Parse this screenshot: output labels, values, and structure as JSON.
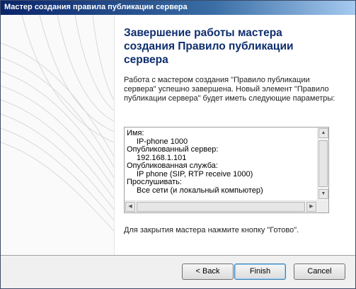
{
  "window": {
    "title": "Мастер создания правила публикации сервера"
  },
  "wizard": {
    "heading": "Завершение работы мастера создания Правило публикации сервера",
    "intro": "Работа с мастером создания \"Правило публикации сервера\" успешно завершена. Новый элемент \"Правило публикации сервера\" будет иметь следующие параметры:",
    "summary": [
      {
        "label": "Имя:",
        "value": "IP-phone 1000"
      },
      {
        "label": "Опубликованный сервер:",
        "value": "192.168.1.101"
      },
      {
        "label": "Опубликованная служба:",
        "value": "IP phone (SIP, RTP receive 1000)"
      },
      {
        "label": "Прослушивать:",
        "value": "Все сети (и локальный компьютер)"
      }
    ],
    "footer_note": "Для закрытия мастера нажмите кнопку \"Готово\"."
  },
  "buttons": {
    "back": "< Back",
    "finish": "Finish",
    "cancel": "Cancel"
  },
  "colors": {
    "heading": "#0e2e6e",
    "titlebar_start": "#0a246a",
    "titlebar_end": "#a6caf0"
  },
  "icons": {
    "scroll_up": "scroll-up-arrow-icon",
    "scroll_down": "scroll-down-arrow-icon",
    "scroll_left": "scroll-left-arrow-icon",
    "scroll_right": "scroll-right-arrow-icon"
  }
}
